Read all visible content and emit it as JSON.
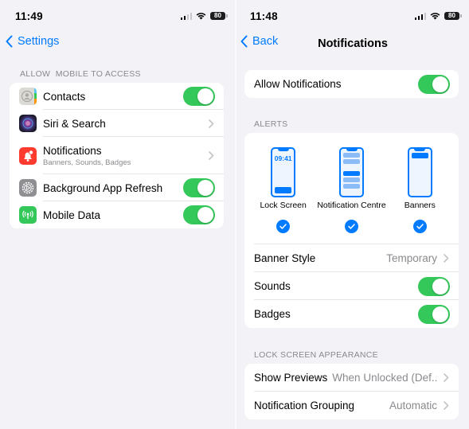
{
  "left_screen": {
    "status": {
      "time": "11:49",
      "battery": "80"
    },
    "nav": {
      "back_label": "Settings"
    },
    "section_header": "ALLOW  MOBILE TO ACCESS",
    "rows": [
      {
        "label": "Contacts",
        "icon": "contacts-icon",
        "icon_color": "#d8d6d1",
        "control": "toggle",
        "toggle_on": true
      },
      {
        "label": "Siri & Search",
        "icon": "siri-icon",
        "icon_color": "#1c1c2e",
        "control": "chevron"
      },
      {
        "label": "Notifications",
        "sublabel": "Banners, Sounds, Badges",
        "icon": "notifications-bell-icon",
        "icon_color": "#ff3b30",
        "control": "chevron"
      },
      {
        "label": "Background App Refresh",
        "icon": "gear-icon",
        "icon_color": "#8e8e93",
        "control": "toggle",
        "toggle_on": true
      },
      {
        "label": "Mobile Data",
        "icon": "antenna-icon",
        "icon_color": "#34c759",
        "control": "toggle",
        "toggle_on": true
      }
    ]
  },
  "right_screen": {
    "status": {
      "time": "11:48",
      "battery": "80"
    },
    "nav": {
      "back_label": "Back",
      "title": "Notifications"
    },
    "allow_notifications": {
      "label": "Allow Notifications",
      "toggle_on": true
    },
    "alerts": {
      "header": "ALERTS",
      "options": [
        {
          "label": "Lock Screen",
          "preview_time": "09:41",
          "checked": true
        },
        {
          "label": "Notification Centre",
          "checked": true
        },
        {
          "label": "Banners",
          "checked": true
        }
      ],
      "rows": [
        {
          "label": "Banner Style",
          "value": "Temporary",
          "control": "chevron"
        },
        {
          "label": "Sounds",
          "control": "toggle",
          "toggle_on": true
        },
        {
          "label": "Badges",
          "control": "toggle",
          "toggle_on": true
        }
      ]
    },
    "lock_screen_appearance": {
      "header": "LOCK SCREEN APPEARANCE",
      "rows": [
        {
          "label": "Show Previews",
          "value": "When Unlocked (Def...",
          "control": "chevron"
        },
        {
          "label": "Notification Grouping",
          "value": "Automatic",
          "control": "chevron"
        }
      ]
    }
  },
  "colors": {
    "accent": "#007aff",
    "toggle_on": "#34c759",
    "background": "#f2f2f7",
    "secondary_text": "#8a8a8e"
  }
}
